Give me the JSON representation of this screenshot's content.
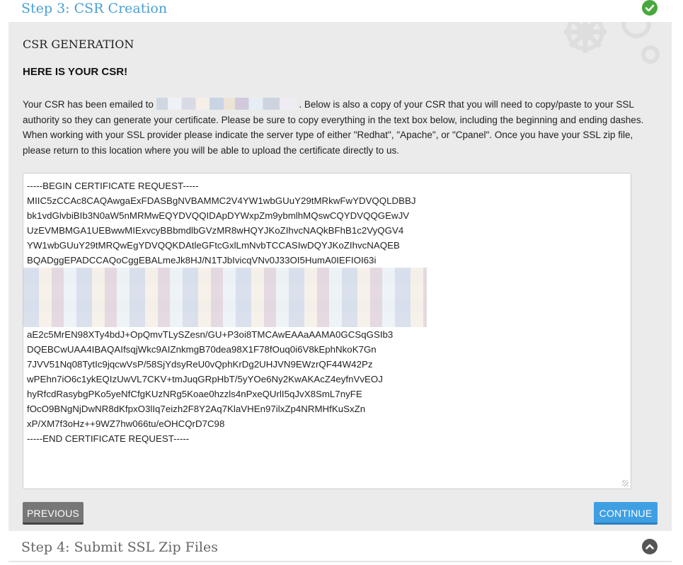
{
  "step3": {
    "title": "Step 3: CSR Creation",
    "status_icon": "check-circle-icon",
    "status_color": "#46a83e"
  },
  "panel": {
    "section_title": "CSR GENERATION",
    "subheading": "HERE IS YOUR CSR!",
    "description_prefix": "Your CSR has been emailed to",
    "description_suffix": ". Below is also a copy of your CSR that you will need to copy/paste to your SSL authority so they can generate your certificate. Please be sure to copy everything in the text box below, including the beginning and ending dashes. When working with your SSL provider please indicate the server type of either \"Redhat\", \"Apache\", or \"Cpanel\". Once you have your SSL zip file, please return to this location where you will be able to upload the certificate directly to us."
  },
  "csr": {
    "lines_top": [
      "-----BEGIN CERTIFICATE REQUEST-----",
      "MIIC5zCCAc8CAQAwgaExFDASBgNVBAMMC2V4YW1wbGUuY29tMRkwFwYDVQQLDBBJ",
      "bk1vdGlvbiBIb3N0aW5nMRMwEQYDVQQIDApDYWxpZm9ybmlhMQswCQYDVQQGEwJV",
      "UzEVMBMGA1UEBwwMIExvcyBBbmdlbGVzMR8wHQYJKoZIhvcNAQkBFhB1c2VyQGV4",
      "YW1wbGUuY29tMRQwEgYDVQQKDAtleGFtcGxlLmNvbTCCASIwDQYJKoZIhvcNAQEB",
      "BQADggEPADCCAQoCggEBALmeJk8HJ/N1TJbIvicqVNv0J33OI5HumA0IEFIOI63i"
    ],
    "lines_bottom": [
      "aE2c5MrEN98XTy4bdJ+OpQmvTLySZesn/GU+P3oi8TMCAwEAAaAAMA0GCSqGSIb3",
      "DQEBCwUAA4IBAQAIfsqjWkc9AIZnkmgB70dea98X1F78fOuq0i6V8kEphNkoK7Gn",
      "7JVV51Nq08TytIc9jqcwVsP/58SjYdsyReU0vQphKrDg2UHJVN9EWzrQF44W42Pz",
      "wPEhn7iO6c1ykEQIzUwVL7CKV+tmJuqGRpHbT/5yYOe6Ny2KwAKAcZ4eyfnVvEOJ",
      "hyRfcdRasybgPKo5yeNfCfgKUzNRg5Koae0hzzls4nPxeQUrlI5qJvX8SmL7nyFE",
      "fOcO9BNgNjDwNR8dKfpxO3lIq7eizh2F8Y2Aq7KlaVHEn97ilxZp4NRMHfKuSxZn",
      "xP/XM7f3oHz++9WZ7hw066tu/eOHCQrD7C98",
      "-----END CERTIFICATE REQUEST-----"
    ]
  },
  "buttons": {
    "previous_label": "PREVIOUS",
    "continue_label": "CONTINUE",
    "continue_color": "#3f9fe3",
    "previous_color": "#777777"
  },
  "step4": {
    "title": "Step 4: Submit SSL Zip Files",
    "status_icon": "chevron-up-circle-icon"
  }
}
